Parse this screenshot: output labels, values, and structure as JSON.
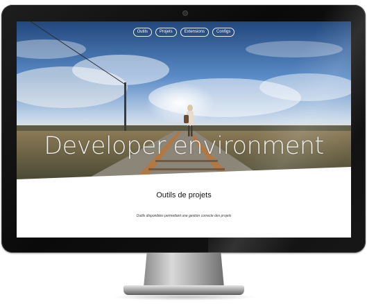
{
  "nav": {
    "items": [
      {
        "label": "Outils"
      },
      {
        "label": "Projets"
      },
      {
        "label": "Extensions"
      },
      {
        "label": "Configs"
      }
    ]
  },
  "hero": {
    "title": "Developer environment"
  },
  "section": {
    "title": "Outils de projets",
    "subtitle": "Outils disponibles permettant une gestion correcte des projets"
  },
  "colors": {
    "sky_top": "#24508a",
    "sky_mid": "#6b9ad0",
    "horizon": "#e9e4d2",
    "ground": "#6d6a4a",
    "rails": "#a0673a"
  }
}
